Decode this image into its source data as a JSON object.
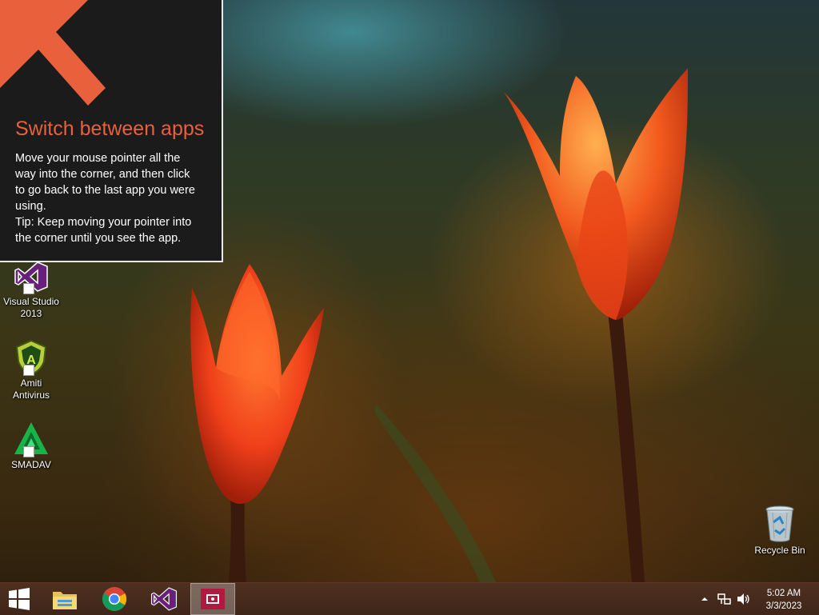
{
  "tutorial": {
    "title": "Switch between apps",
    "lines": [
      "Move your mouse pointer all the",
      "way into the corner, and then click",
      "to go back to the last app you were",
      "using.",
      "Tip: Keep moving your pointer into",
      "the corner until you see the app."
    ],
    "accent_color": "#e8603c"
  },
  "desktop_icons": [
    {
      "label_line1": "Visual Studio",
      "label_line2": "2013",
      "icon": "visual-studio-icon"
    },
    {
      "label_line1": "Amiti",
      "label_line2": "Antivirus",
      "icon": "amiti-antivirus-icon"
    },
    {
      "label_line1": "SMADAV",
      "label_line2": "",
      "icon": "smadav-icon"
    },
    {
      "label_line1": "Recycle Bin",
      "label_line2": "",
      "icon": "recycle-bin-icon"
    }
  ],
  "taskbar": {
    "buttons": [
      {
        "name": "start",
        "icon": "windows-logo-icon"
      },
      {
        "name": "file-explorer",
        "icon": "folder-icon"
      },
      {
        "name": "chrome",
        "icon": "chrome-icon"
      },
      {
        "name": "visual-studio",
        "icon": "visual-studio-icon"
      },
      {
        "name": "active-app",
        "icon": "app-window-icon",
        "active": true
      }
    ],
    "time": "5:02 AM",
    "date": "3/3/2023"
  }
}
